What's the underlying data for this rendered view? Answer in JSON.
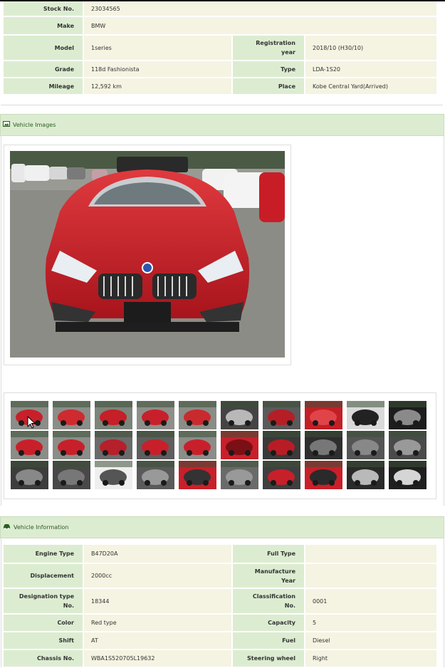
{
  "top_specs": {
    "stock_no_label": "Stock No.",
    "stock_no": "23034565",
    "make_label": "Make",
    "make": "BMW",
    "model_label": "Model",
    "model": "1series",
    "registration_year_label_1": "Registration",
    "registration_year_label_2": "year",
    "registration_year": "2018/10 (H30/10)",
    "grade_label": "Grade",
    "grade": "118d Fashionista",
    "type_label": "Type",
    "type": "LDA-1S20",
    "mileage_label": "Mileage",
    "mileage": "12,592 km",
    "place_label": "Place",
    "place": "Kobe Central Yard(Arrived)"
  },
  "vehicle_images": {
    "title": "Vehicle Images",
    "icon": "image-icon",
    "thumbnail_count": 30
  },
  "vehicle_info": {
    "title": "Vehicle Information",
    "icon": "car-icon",
    "engine_type_label": "Engine Type",
    "engine_type": "B47D20A",
    "full_type_label": "Full Type",
    "full_type": "",
    "displacement_label": "Displacement",
    "displacement": "2000cc",
    "manufacture_year_label_1": "Manufacture",
    "manufacture_year_label_2": "Year",
    "manufacture_year": "",
    "designation_label_1": "Designation type",
    "designation_label_2": "No.",
    "designation": "18344",
    "classification_label_1": "Classification",
    "classification_label_2": "No.",
    "classification": "0001",
    "color_label": "Color",
    "color": "Red type",
    "capacity_label": "Capacity",
    "capacity": "5",
    "shift_label": "Shift",
    "shift": "AT",
    "fuel_label": "Fuel",
    "fuel": "Diesel",
    "chassis_label": "Chassis No.",
    "chassis": "WBA1S520705L19632",
    "steering_label": "Steering wheel",
    "steering": "Right"
  },
  "colors": {
    "header_green": "#dcecd1",
    "label_cell": "#dcecd1",
    "value_cell": "#f5f3e2",
    "car_red": "#c8202a",
    "header_text": "#2b5d20"
  }
}
